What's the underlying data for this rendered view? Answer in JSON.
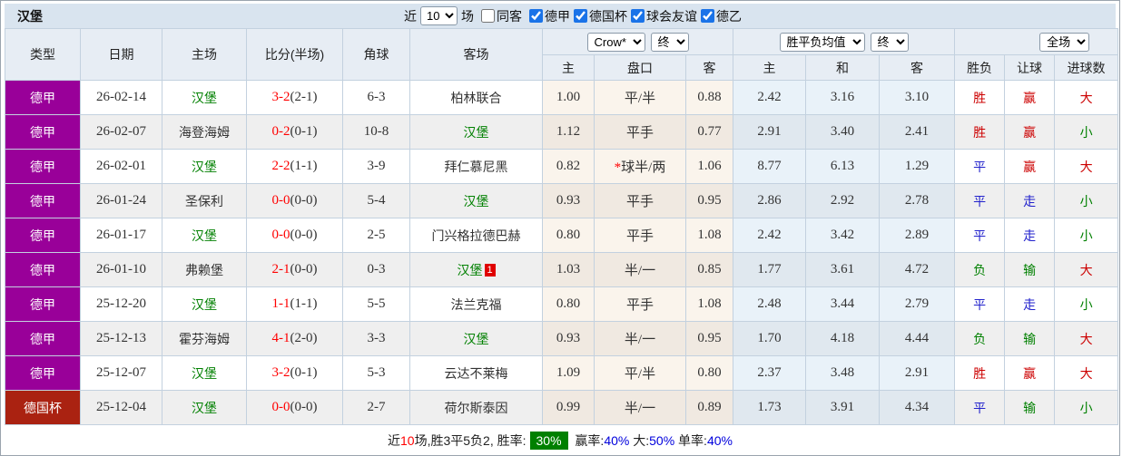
{
  "header_bar": {
    "team_name": "汉堡",
    "recent_label": "近",
    "recent_count": "10",
    "games_label": "场",
    "same_opponent_label": "同客",
    "league_filters": [
      {
        "label": "德甲",
        "checked": true
      },
      {
        "label": "德国杯",
        "checked": true
      },
      {
        "label": "球会友谊",
        "checked": true
      },
      {
        "label": "德乙",
        "checked": true
      }
    ]
  },
  "table": {
    "main_headers": [
      "类型",
      "日期",
      "主场",
      "比分(半场)",
      "角球",
      "客场"
    ],
    "sub_headers": [
      "主",
      "盘口",
      "客",
      "主",
      "和",
      "客",
      "胜负",
      "让球",
      "进球数"
    ],
    "selects": {
      "bookmaker": "Crow*",
      "bookmaker_time": "终",
      "avg_group": "胜平负均值",
      "avg_time": "终",
      "scope": "全场"
    },
    "rows": [
      {
        "league": "德甲",
        "league_color": "#990099",
        "date": "26-02-14",
        "home": "汉堡",
        "home_color": "#008000",
        "score": "3-2",
        "half": "(2-1)",
        "corners": "6-3",
        "away": "柏林联合",
        "away_color": "#333333",
        "away_badge": "",
        "odds_home": "1.00",
        "handicap": "平/半",
        "handicap_star": false,
        "odds_away": "0.88",
        "avg_home": "2.42",
        "avg_draw": "3.16",
        "avg_away": "3.10",
        "result": "胜",
        "result_color": "#cc0000",
        "handicap_result": "赢",
        "handicap_result_color": "#cc0000",
        "goals": "大",
        "goals_color": "#cc0000"
      },
      {
        "league": "德甲",
        "league_color": "#990099",
        "date": "26-02-07",
        "home": "海登海姆",
        "home_color": "#333333",
        "score": "0-2",
        "half": "(0-1)",
        "corners": "10-8",
        "away": "汉堡",
        "away_color": "#008000",
        "away_badge": "",
        "odds_home": "1.12",
        "handicap": "平手",
        "handicap_star": false,
        "odds_away": "0.77",
        "avg_home": "2.91",
        "avg_draw": "3.40",
        "avg_away": "2.41",
        "result": "胜",
        "result_color": "#cc0000",
        "handicap_result": "赢",
        "handicap_result_color": "#cc0000",
        "goals": "小",
        "goals_color": "#008000"
      },
      {
        "league": "德甲",
        "league_color": "#990099",
        "date": "26-02-01",
        "home": "汉堡",
        "home_color": "#008000",
        "score": "2-2",
        "half": "(1-1)",
        "corners": "3-9",
        "away": "拜仁慕尼黑",
        "away_color": "#333333",
        "away_badge": "",
        "odds_home": "0.82",
        "handicap": "球半/两",
        "handicap_star": true,
        "odds_away": "1.06",
        "avg_home": "8.77",
        "avg_draw": "6.13",
        "avg_away": "1.29",
        "result": "平",
        "result_color": "#2222cc",
        "handicap_result": "赢",
        "handicap_result_color": "#cc0000",
        "goals": "大",
        "goals_color": "#cc0000"
      },
      {
        "league": "德甲",
        "league_color": "#990099",
        "date": "26-01-24",
        "home": "圣保利",
        "home_color": "#333333",
        "score": "0-0",
        "half": "(0-0)",
        "corners": "5-4",
        "away": "汉堡",
        "away_color": "#008000",
        "away_badge": "",
        "odds_home": "0.93",
        "handicap": "平手",
        "handicap_star": false,
        "odds_away": "0.95",
        "avg_home": "2.86",
        "avg_draw": "2.92",
        "avg_away": "2.78",
        "result": "平",
        "result_color": "#2222cc",
        "handicap_result": "走",
        "handicap_result_color": "#2222cc",
        "goals": "小",
        "goals_color": "#008000"
      },
      {
        "league": "德甲",
        "league_color": "#990099",
        "date": "26-01-17",
        "home": "汉堡",
        "home_color": "#008000",
        "score": "0-0",
        "half": "(0-0)",
        "corners": "2-5",
        "away": "门兴格拉德巴赫",
        "away_color": "#333333",
        "away_badge": "",
        "odds_home": "0.80",
        "handicap": "平手",
        "handicap_star": false,
        "odds_away": "1.08",
        "avg_home": "2.42",
        "avg_draw": "3.42",
        "avg_away": "2.89",
        "result": "平",
        "result_color": "#2222cc",
        "handicap_result": "走",
        "handicap_result_color": "#2222cc",
        "goals": "小",
        "goals_color": "#008000"
      },
      {
        "league": "德甲",
        "league_color": "#990099",
        "date": "26-01-10",
        "home": "弗赖堡",
        "home_color": "#333333",
        "score": "2-1",
        "half": "(0-0)",
        "corners": "0-3",
        "away": "汉堡",
        "away_color": "#008000",
        "away_badge": "1",
        "odds_home": "1.03",
        "handicap": "半/一",
        "handicap_star": false,
        "odds_away": "0.85",
        "avg_home": "1.77",
        "avg_draw": "3.61",
        "avg_away": "4.72",
        "result": "负",
        "result_color": "#008000",
        "handicap_result": "输",
        "handicap_result_color": "#008000",
        "goals": "大",
        "goals_color": "#cc0000"
      },
      {
        "league": "德甲",
        "league_color": "#990099",
        "date": "25-12-20",
        "home": "汉堡",
        "home_color": "#008000",
        "score": "1-1",
        "half": "(1-1)",
        "corners": "5-5",
        "away": "法兰克福",
        "away_color": "#333333",
        "away_badge": "",
        "odds_home": "0.80",
        "handicap": "平手",
        "handicap_star": false,
        "odds_away": "1.08",
        "avg_home": "2.48",
        "avg_draw": "3.44",
        "avg_away": "2.79",
        "result": "平",
        "result_color": "#2222cc",
        "handicap_result": "走",
        "handicap_result_color": "#2222cc",
        "goals": "小",
        "goals_color": "#008000"
      },
      {
        "league": "德甲",
        "league_color": "#990099",
        "date": "25-12-13",
        "home": "霍芬海姆",
        "home_color": "#333333",
        "score": "4-1",
        "half": "(2-0)",
        "corners": "3-3",
        "away": "汉堡",
        "away_color": "#008000",
        "away_badge": "",
        "odds_home": "0.93",
        "handicap": "半/一",
        "handicap_star": false,
        "odds_away": "0.95",
        "avg_home": "1.70",
        "avg_draw": "4.18",
        "avg_away": "4.44",
        "result": "负",
        "result_color": "#008000",
        "handicap_result": "输",
        "handicap_result_color": "#008000",
        "goals": "大",
        "goals_color": "#cc0000"
      },
      {
        "league": "德甲",
        "league_color": "#990099",
        "date": "25-12-07",
        "home": "汉堡",
        "home_color": "#008000",
        "score": "3-2",
        "half": "(0-1)",
        "corners": "5-3",
        "away": "云达不莱梅",
        "away_color": "#333333",
        "away_badge": "",
        "odds_home": "1.09",
        "handicap": "平/半",
        "handicap_star": false,
        "odds_away": "0.80",
        "avg_home": "2.37",
        "avg_draw": "3.48",
        "avg_away": "2.91",
        "result": "胜",
        "result_color": "#cc0000",
        "handicap_result": "赢",
        "handicap_result_color": "#cc0000",
        "goals": "大",
        "goals_color": "#cc0000"
      },
      {
        "league": "德国杯",
        "league_color": "#aa2211",
        "date": "25-12-04",
        "home": "汉堡",
        "home_color": "#008000",
        "score": "0-0",
        "half": "(0-0)",
        "corners": "2-7",
        "away": "荷尔斯泰因",
        "away_color": "#333333",
        "away_badge": "",
        "odds_home": "0.99",
        "handicap": "半/一",
        "handicap_star": false,
        "odds_away": "0.89",
        "avg_home": "1.73",
        "avg_draw": "3.91",
        "avg_away": "4.34",
        "result": "平",
        "result_color": "#2222cc",
        "handicap_result": "输",
        "handicap_result_color": "#008000",
        "goals": "小",
        "goals_color": "#008000"
      }
    ]
  },
  "footer": {
    "prefix": "近",
    "count": "10",
    "summary": "场,胜3平5负2, 胜率:",
    "win_rate": "30%",
    "win_label": " 赢率:",
    "win_pct": "40%",
    "big_label": " 大:",
    "big_pct": "50%",
    "single_label": " 单率:",
    "single_pct": "40%"
  },
  "colors": {
    "league_dejia": "#990099",
    "league_cup": "#aa2211",
    "team_highlight": "#008000",
    "win_red": "#cc0000",
    "draw_blue": "#2222cc",
    "loss_green": "#008000",
    "score_red": "#ff0000",
    "rate_chip_bg": "#008000",
    "pct_blue": "#0000dd",
    "topbar_bg": "#d9e4ef"
  }
}
